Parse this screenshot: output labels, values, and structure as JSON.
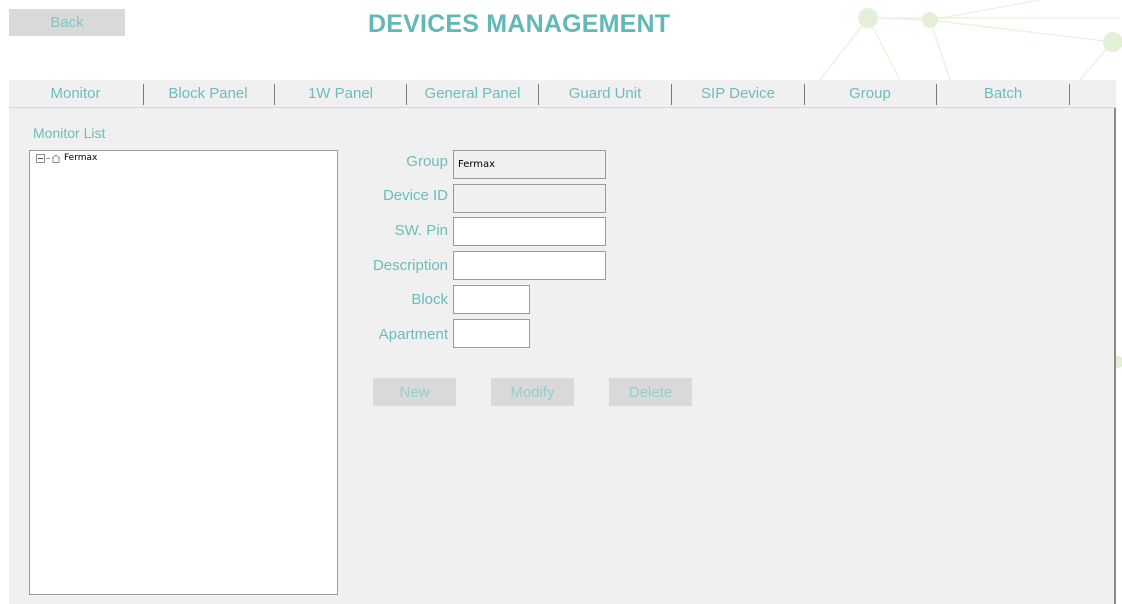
{
  "header": {
    "back_label": "Back",
    "title": "DEVICES MANAGEMENT"
  },
  "tabs": [
    {
      "label": "Monitor"
    },
    {
      "label": "Block Panel"
    },
    {
      "label": "1W Panel"
    },
    {
      "label": "General Panel"
    },
    {
      "label": "Guard Unit"
    },
    {
      "label": "SIP Device"
    },
    {
      "label": "Group"
    },
    {
      "label": "Batch"
    }
  ],
  "monitor_list": {
    "label": "Monitor List",
    "tree": [
      {
        "label": "Fermax",
        "icon": "home-icon",
        "expanded": true
      }
    ]
  },
  "form": {
    "group": {
      "label": "Group",
      "value": "Fermax"
    },
    "device_id": {
      "label": "Device ID",
      "value": ""
    },
    "sw_pin": {
      "label": "SW. Pin",
      "value": ""
    },
    "description": {
      "label": "Description",
      "value": ""
    },
    "block": {
      "label": "Block",
      "value": ""
    },
    "apartment": {
      "label": "Apartment",
      "value": ""
    }
  },
  "actions": {
    "new_label": "New",
    "modify_label": "Modify",
    "delete_label": "Delete"
  },
  "colors": {
    "accent": "#62b8b6",
    "panel_bg": "#f0f0f0",
    "button_bg": "#d9d9d9"
  }
}
